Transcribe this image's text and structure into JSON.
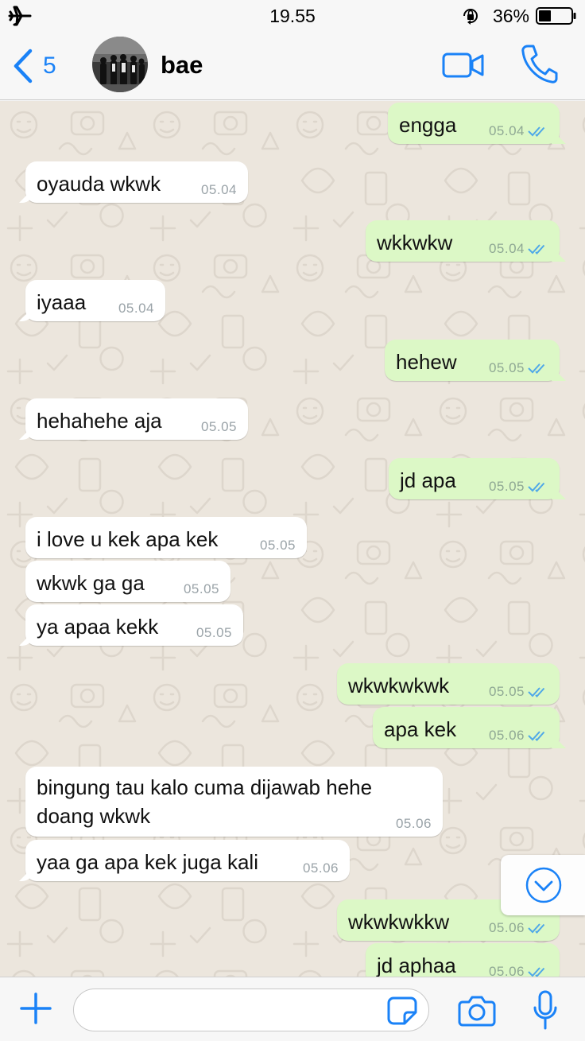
{
  "status_bar": {
    "time": "19.55",
    "battery_percent": "36%"
  },
  "header": {
    "back_count": "5",
    "contact_name": "bae"
  },
  "messages": [
    {
      "dir": "out",
      "text": "engga",
      "time": "05.04"
    },
    {
      "dir": "in",
      "text": "oyauda wkwk",
      "time": "05.04"
    },
    {
      "dir": "out",
      "text": "wkkwkw",
      "time": "05.04"
    },
    {
      "dir": "in",
      "text": "iyaaa",
      "time": "05.04"
    },
    {
      "dir": "out",
      "text": "hehew",
      "time": "05.05"
    },
    {
      "dir": "in",
      "text": "hehahehe aja",
      "time": "05.05"
    },
    {
      "dir": "out",
      "text": "jd apa",
      "time": "05.05"
    },
    {
      "dir": "in",
      "text": "i love u kek apa kek",
      "time": "05.05"
    },
    {
      "dir": "in",
      "text": "wkwk ga ga",
      "time": "05.05"
    },
    {
      "dir": "in",
      "text": "ya apaa kekk",
      "time": "05.05"
    },
    {
      "dir": "out",
      "text": "wkwkwkwk",
      "time": "05.05"
    },
    {
      "dir": "out",
      "text": "apa kek",
      "time": "05.06"
    },
    {
      "dir": "in",
      "text": "bingung tau kalo cuma dijawab hehe doang wkwk",
      "time": "05.06"
    },
    {
      "dir": "in",
      "text": "yaa ga apa kek juga kali",
      "time": "05.06"
    },
    {
      "dir": "out",
      "text": "wkwkwkkw",
      "time": "05.06"
    },
    {
      "dir": "out",
      "text": "jd aphaa",
      "time": "05.06"
    }
  ],
  "input": {
    "value": "",
    "placeholder": ""
  },
  "colors": {
    "accent": "#1a82f7",
    "outgoing_bubble": "#dcf8c6",
    "incoming_bubble": "#ffffff",
    "chat_background": "#ece6dd",
    "read_ticks": "#4fa8e8"
  },
  "icons": {
    "status_bar": [
      "airplane-mode-icon",
      "rotation-lock-icon",
      "battery-icon"
    ],
    "header": [
      "back-chevron-icon",
      "video-call-icon",
      "phone-call-icon"
    ],
    "input_bar": [
      "plus-icon",
      "sticker-icon",
      "camera-icon",
      "microphone-icon"
    ],
    "chat": [
      "scroll-down-icon",
      "double-check-icon"
    ]
  }
}
